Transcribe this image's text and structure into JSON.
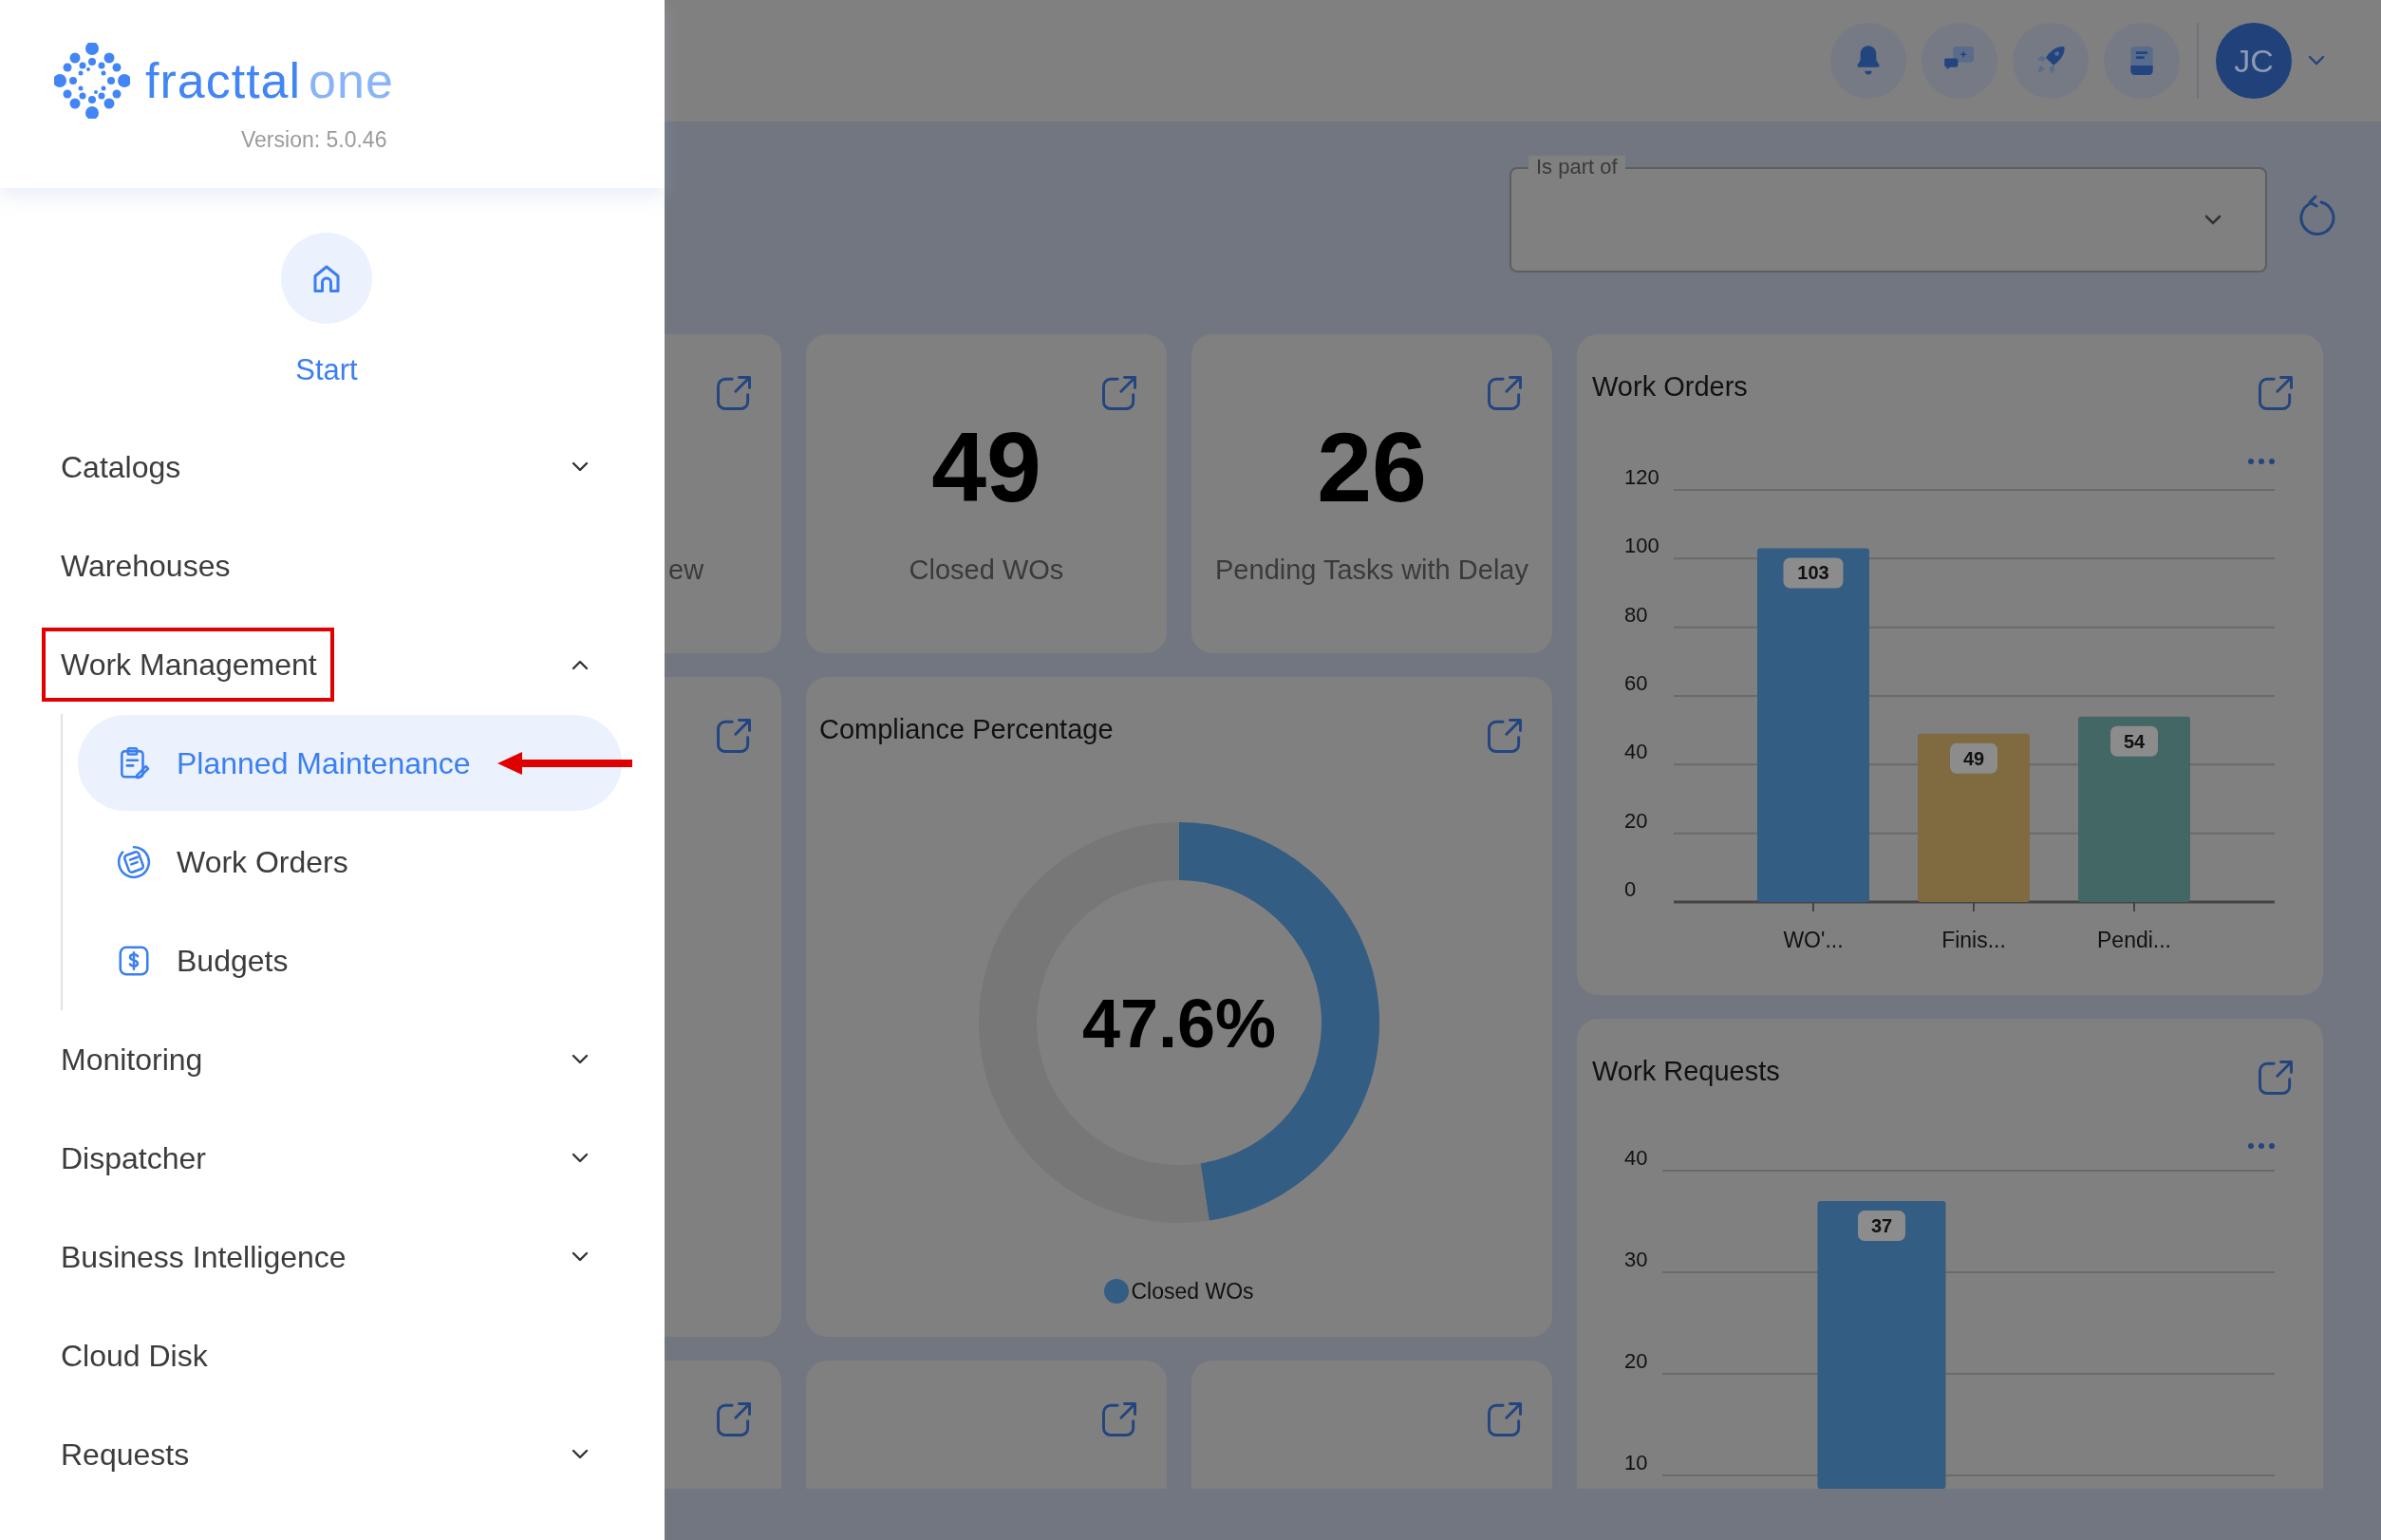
{
  "sidebar": {
    "brand": {
      "name": "fracttal",
      "suffix": "one"
    },
    "version": "Version: 5.0.46",
    "start": {
      "label": "Start"
    },
    "menu": [
      {
        "label": "Catalogs",
        "kind": "group",
        "expanded": false,
        "annotated": false
      },
      {
        "label": "Warehouses",
        "kind": "link",
        "annotated": false
      },
      {
        "label": "Work Management",
        "kind": "group",
        "expanded": true,
        "annotated": true,
        "children": [
          {
            "label": "Planned Maintenance",
            "selected": true,
            "pointed": true
          },
          {
            "label": "Work Orders",
            "selected": false,
            "pointed": false
          },
          {
            "label": "Budgets",
            "selected": false,
            "pointed": false
          }
        ]
      },
      {
        "label": "Monitoring",
        "kind": "group",
        "expanded": false,
        "annotated": false
      },
      {
        "label": "Dispatcher",
        "kind": "group",
        "expanded": false,
        "annotated": false
      },
      {
        "label": "Business Intelligence",
        "kind": "group",
        "expanded": false,
        "annotated": false
      },
      {
        "label": "Cloud Disk",
        "kind": "link",
        "annotated": false
      },
      {
        "label": "Requests",
        "kind": "group",
        "expanded": false,
        "annotated": false
      }
    ]
  },
  "topbar": {
    "avatar": "JC"
  },
  "filter": {
    "label": "Is part of"
  },
  "stat_cards": [
    {
      "label": "ew"
    },
    {
      "value": "49",
      "label": "Closed WOs"
    },
    {
      "value": "26",
      "label": "Pending Tasks with Delay"
    }
  ],
  "compliance": {
    "title": "Compliance Percentage",
    "center_label": "47.6%",
    "chart_data": {
      "type": "donut",
      "categories": [
        "Closed WOs",
        null
      ],
      "values": [
        47.6,
        52.4
      ],
      "colors": [
        "#335d82",
        "#777777"
      ]
    }
  },
  "work_orders": {
    "title": "Work Orders",
    "chart_data": {
      "type": "bar",
      "categories": [
        "WO'...",
        "Finis...",
        "Pendi..."
      ],
      "values": [
        103,
        49,
        54
      ],
      "colors": [
        "#335d82",
        "#806a40",
        "#436764"
      ],
      "ylim": [
        0,
        120
      ],
      "yticks": [
        0,
        20,
        40,
        60,
        80,
        100,
        120
      ],
      "grid": true,
      "data_labels": true
    }
  },
  "work_requests": {
    "title": "Work Requests",
    "chart_data": {
      "type": "bar",
      "values": [
        37
      ],
      "colors": [
        "#335d82"
      ],
      "ylim": [
        8.7,
        40
      ],
      "yticks": [
        10,
        20,
        30,
        40
      ],
      "grid": true,
      "data_labels": true
    }
  }
}
